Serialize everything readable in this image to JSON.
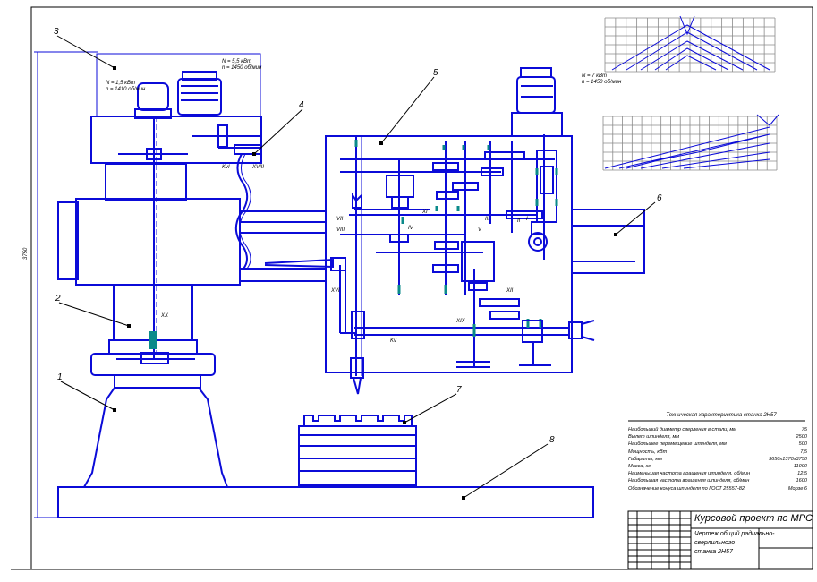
{
  "title_block": {
    "title": "Курсовой проект по МРС",
    "subtitle_line1": "Чертеж общий радиально-",
    "subtitle_line2": "сверлильного",
    "subtitle_line3": "станка 2Н57"
  },
  "tech_table": {
    "heading": "Техническая характеристика станка 2Н57",
    "rows": [
      {
        "label": "Наибольший диаметр сверления в стали, мм",
        "value": "75"
      },
      {
        "label": "Вылет шпинделя, мм",
        "value": "2500"
      },
      {
        "label": "Наибольшее перемещение шпинделя, мм",
        "value": "500"
      },
      {
        "label": "Мощность, кВт",
        "value": "7,5"
      },
      {
        "label": "Габариты, мм",
        "value": "3650х1370х3750"
      },
      {
        "label": "Масса, кг",
        "value": "11000"
      },
      {
        "label": "Наименьшая частота вращения шпинделя, об/мин",
        "value": "12,5"
      },
      {
        "label": "Наибольшая частота вращения шпинделя, об/мин",
        "value": "1600"
      },
      {
        "label": "Обозначение конуса шпинделя по ГОСТ 25557-82",
        "value": "Морзе 6"
      }
    ]
  },
  "callouts": [
    "1",
    "2",
    "3",
    "4",
    "5",
    "6",
    "7",
    "8"
  ],
  "motor_note_1": {
    "line1": "N = 1,5 кВт",
    "line2": "n = 1410 об/мин"
  },
  "motor_note_2": {
    "line1": "N = 5,5 кВт",
    "line2": "n = 1450 об/мин"
  },
  "motor_note_3": {
    "line1": "N = 7 кВт",
    "line2": "n = 1450 об/мин"
  },
  "shaft_labels": [
    "KvI",
    "XVIII",
    "VII",
    "VIII",
    "XVI",
    "XX",
    "Kv",
    "XIX",
    "XI",
    "XII",
    "III",
    "II",
    "I",
    "IV",
    "V"
  ],
  "dimension_label": "3750",
  "colors": {
    "drawing": "#0b0bd8",
    "frame": "#000000",
    "grid": "#8a8a8a",
    "teal": "#0a8a8a"
  }
}
